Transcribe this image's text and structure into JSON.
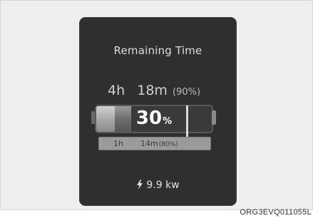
{
  "screen": {
    "title": "Remaining Time",
    "estimate_full": {
      "hours": "4h",
      "minutes": "18m",
      "percent": "(90%)"
    },
    "battery": {
      "charge_value": "30",
      "charge_unit": "%",
      "charge_level": 0.3
    },
    "estimate_target": {
      "hours": "1h",
      "minutes": "14m",
      "percent": "(80%)"
    },
    "charging_power": "9.9 kw"
  },
  "image_code": "ORG3EVQ011055L",
  "colors": {
    "panel": "#2f2f2f",
    "text": "#dcdcdc",
    "battery_fill": "#6e6e6e"
  },
  "icons": [
    "lightning-bolt-icon"
  ]
}
